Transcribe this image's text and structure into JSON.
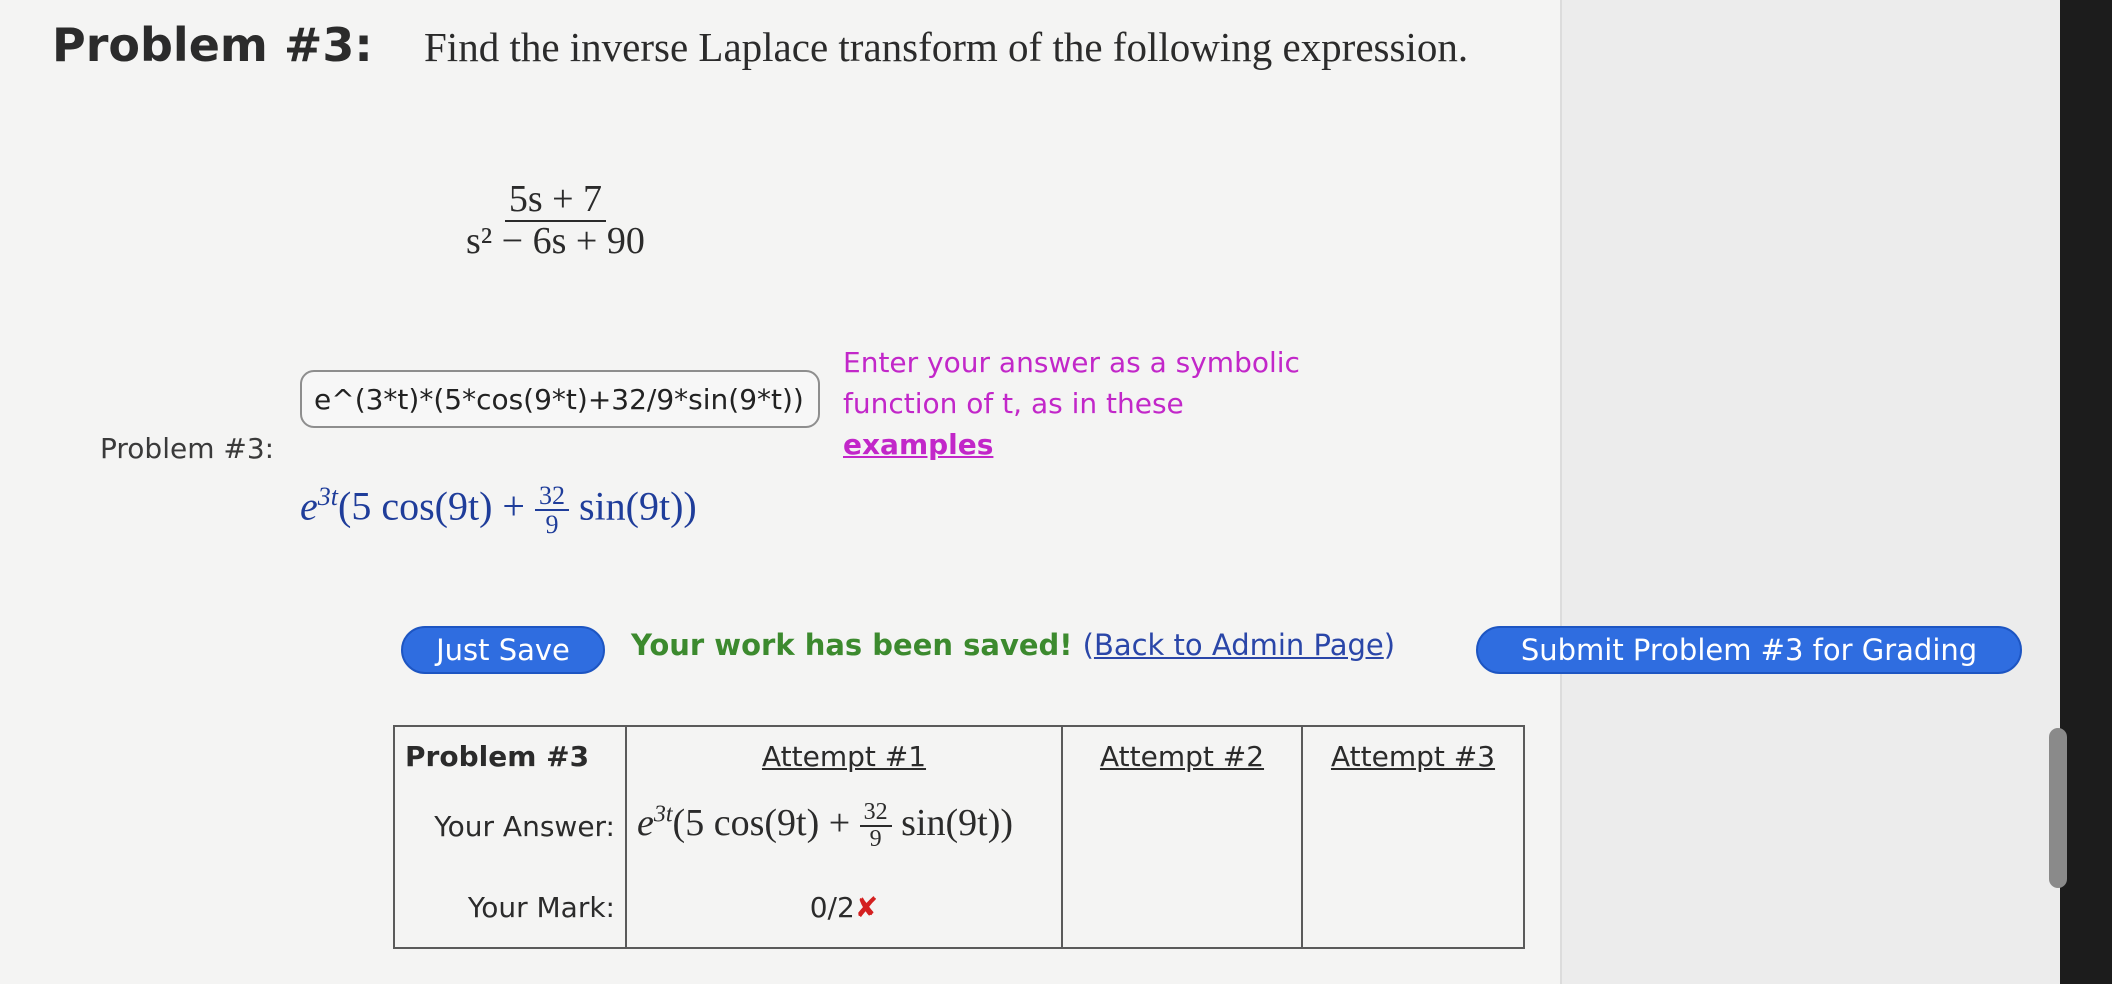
{
  "problem": {
    "title": "Problem #3:",
    "statement": "Find the inverse Laplace transform of the following expression.",
    "expr_numerator": "5s + 7",
    "expr_denominator": "s² − 6s + 90"
  },
  "answer": {
    "label": "Problem #3:",
    "input_value": "e^(3*t)*(5*cos(9*t)+32/9*sin(9*t))",
    "hint_line1": "Enter your answer as a symbolic",
    "hint_line2": "function of t, as in these",
    "hint_link": "examples",
    "preview_base": "e",
    "preview_exp": "3t",
    "preview_part1": "(5 cos(9t) +",
    "preview_frac_num": "32",
    "preview_frac_den": "9",
    "preview_part2": "sin(9t))"
  },
  "actions": {
    "save_label": "Just Save",
    "saved_message": "Your work has been saved!",
    "back_link_open": "(",
    "back_link": "Back to Admin Page",
    "back_link_close": ")",
    "submit_label": "Submit Problem #3 for Grading"
  },
  "table": {
    "header_problem": "Problem #3",
    "attempt1": "Attempt #1",
    "attempt2": "Attempt #2",
    "attempt3": "Attempt #3",
    "your_answer_label": "Your Answer:",
    "your_mark_label": "Your Mark:",
    "answer1_base": "e",
    "answer1_exp": "3t",
    "answer1_part1": "(5 cos(9t) +",
    "answer1_frac_num": "32",
    "answer1_frac_den": "9",
    "answer1_part2": "sin(9t))",
    "mark1": "0/2",
    "mark1_icon": "✘"
  },
  "colors": {
    "hint": "#c227c9",
    "button": "#2f6de0",
    "saved": "#3c8a2e",
    "preview": "#1f3d9a",
    "error": "#d42020"
  }
}
